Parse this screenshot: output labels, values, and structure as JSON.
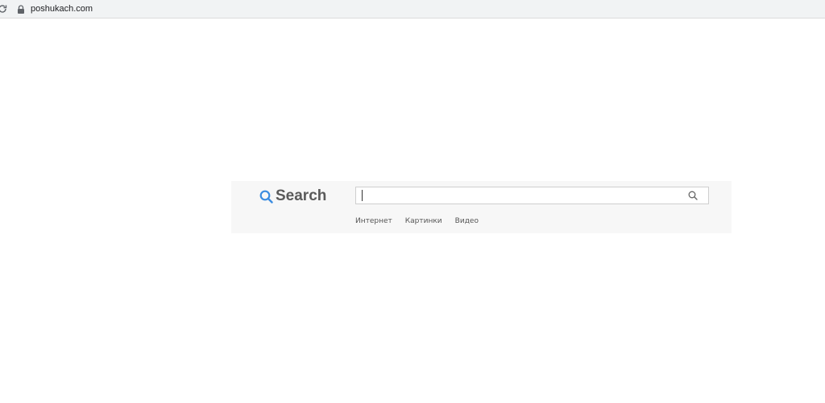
{
  "browser": {
    "url": "poshukach.com",
    "reload_icon": "reload-icon",
    "lock_icon": "lock-icon"
  },
  "logo": {
    "icon": "search-icon",
    "text": "Search",
    "icon_color": "#3b8ce0"
  },
  "search": {
    "value": "",
    "button_icon": "magnifier-icon"
  },
  "tabs": [
    {
      "label": "Интернет"
    },
    {
      "label": "Картинки"
    },
    {
      "label": "Видео"
    }
  ]
}
